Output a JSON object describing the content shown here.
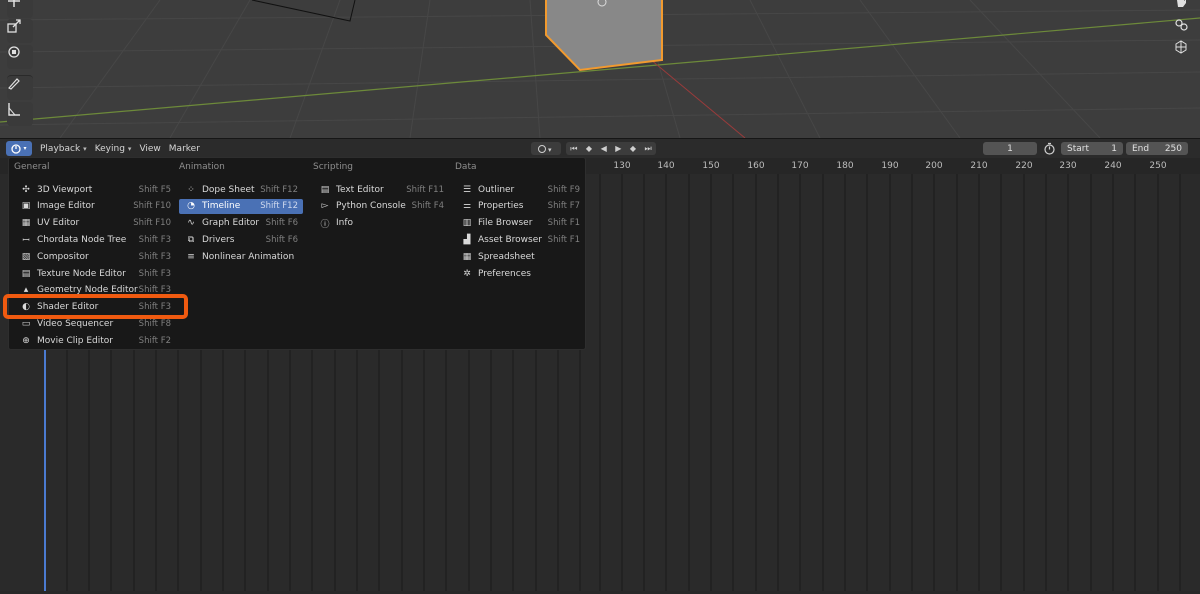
{
  "header": {
    "menus": [
      "Playback",
      "Keying",
      "View",
      "Marker"
    ],
    "menus_with_chevron": [
      true,
      true,
      false,
      false
    ],
    "current_frame": "1",
    "start_label": "Start",
    "start_value": "1",
    "end_label": "End",
    "end_value": "250"
  },
  "ruler": {
    "frames": [
      "130",
      "140",
      "150",
      "160",
      "170",
      "180",
      "190",
      "200",
      "210",
      "220",
      "230",
      "240",
      "250"
    ]
  },
  "editor_menu": {
    "columns": [
      {
        "title": "General",
        "items": [
          {
            "label": "3D Viewport",
            "shortcut": "Shift F5",
            "icon": "3d-viewport-icon"
          },
          {
            "label": "Image Editor",
            "shortcut": "Shift F10",
            "icon": "image-editor-icon"
          },
          {
            "label": "UV Editor",
            "shortcut": "Shift F10",
            "icon": "uv-editor-icon"
          },
          {
            "label": "Chordata Node Tree",
            "shortcut": "Shift F3",
            "icon": "chordata-node-tree-icon"
          },
          {
            "label": "Compositor",
            "shortcut": "Shift F3",
            "icon": "compositor-icon"
          },
          {
            "label": "Texture Node Editor",
            "shortcut": "Shift F3",
            "icon": "texture-node-editor-icon"
          },
          {
            "label": "Geometry Node Editor",
            "shortcut": "Shift F3",
            "icon": "geometry-node-editor-icon"
          },
          {
            "label": "Shader Editor",
            "shortcut": "Shift F3",
            "icon": "shader-editor-icon"
          },
          {
            "label": "Video Sequencer",
            "shortcut": "Shift F8",
            "icon": "video-sequencer-icon"
          },
          {
            "label": "Movie Clip Editor",
            "shortcut": "Shift F2",
            "icon": "movie-clip-editor-icon"
          }
        ]
      },
      {
        "title": "Animation",
        "items": [
          {
            "label": "Dope Sheet",
            "shortcut": "Shift F12",
            "icon": "dope-sheet-icon"
          },
          {
            "label": "Timeline",
            "shortcut": "Shift F12",
            "icon": "timeline-icon",
            "active": true
          },
          {
            "label": "Graph Editor",
            "shortcut": "Shift F6",
            "icon": "graph-editor-icon"
          },
          {
            "label": "Drivers",
            "shortcut": "Shift F6",
            "icon": "drivers-icon"
          },
          {
            "label": "Nonlinear Animation",
            "shortcut": "",
            "icon": "nonlinear-animation-icon"
          }
        ]
      },
      {
        "title": "Scripting",
        "items": [
          {
            "label": "Text Editor",
            "shortcut": "Shift F11",
            "icon": "text-editor-icon"
          },
          {
            "label": "Python Console",
            "shortcut": "Shift F4",
            "icon": "python-console-icon"
          },
          {
            "label": "Info",
            "shortcut": "",
            "icon": "info-icon"
          }
        ]
      },
      {
        "title": "Data",
        "items": [
          {
            "label": "Outliner",
            "shortcut": "Shift F9",
            "icon": "outliner-icon"
          },
          {
            "label": "Properties",
            "shortcut": "Shift F7",
            "icon": "properties-icon"
          },
          {
            "label": "File Browser",
            "shortcut": "Shift F1",
            "icon": "file-browser-icon"
          },
          {
            "label": "Asset Browser",
            "shortcut": "Shift F1",
            "icon": "asset-browser-icon"
          },
          {
            "label": "Spreadsheet",
            "shortcut": "",
            "icon": "spreadsheet-icon"
          },
          {
            "label": "Preferences",
            "shortcut": "",
            "icon": "preferences-icon"
          }
        ]
      }
    ]
  },
  "colors": {
    "accent": "#4a71b5",
    "highlight_box": "#f05a10",
    "selected_object": "#f29a2e"
  }
}
